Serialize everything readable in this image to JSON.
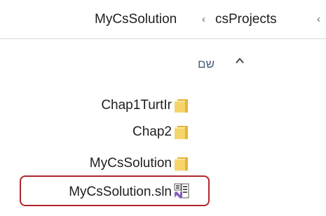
{
  "address_bar": {
    "crumbs": [
      "MyCsSolution",
      "csProjects"
    ],
    "separator": "‹"
  },
  "column_header": {
    "name_label": "שם"
  },
  "files": [
    {
      "name": "Chap1TurtIr",
      "type": "folder"
    },
    {
      "name": "Chap2",
      "type": "folder"
    },
    {
      "name": "MyCsSolution",
      "type": "folder"
    },
    {
      "name": "MyCsSolution.sln",
      "type": "visual-studio-solution",
      "highlighted": true
    }
  ],
  "colors": {
    "folder_yellow": "#f5d46a",
    "folder_edge": "#e6b43a",
    "highlight_border": "#b2262d",
    "header_text": "#4c607a"
  }
}
